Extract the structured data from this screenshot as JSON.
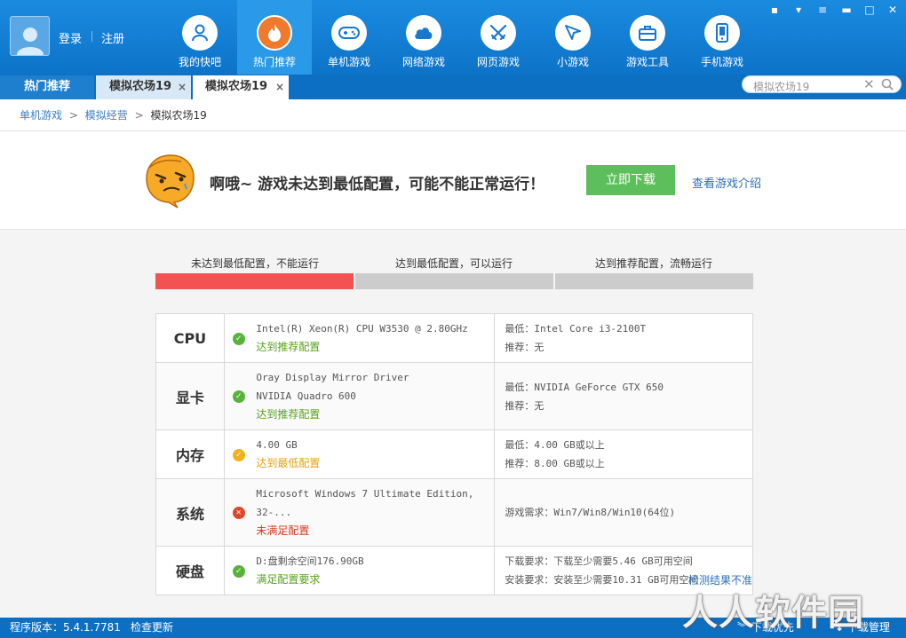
{
  "header": {
    "login": "登录",
    "register": "注册",
    "nav": [
      {
        "label": "我的快吧",
        "icon": "user-icon"
      },
      {
        "label": "热门推荐",
        "icon": "flame-icon",
        "active": true
      },
      {
        "label": "单机游戏",
        "icon": "gamepad-icon"
      },
      {
        "label": "网络游戏",
        "icon": "cloud-icon"
      },
      {
        "label": "网页游戏",
        "icon": "crossed-swords-icon"
      },
      {
        "label": "小游戏",
        "icon": "cursor-arrow-icon"
      },
      {
        "label": "游戏工具",
        "icon": "toolbox-icon"
      },
      {
        "label": "手机游戏",
        "icon": "phone-icon"
      }
    ],
    "window_controls": [
      "chat-icon",
      "shirt-icon",
      "menu-icon",
      "minimize-icon",
      "maximize-icon",
      "close-icon"
    ]
  },
  "tabs": {
    "hot": "热门推荐",
    "game1": "模拟农场19",
    "game2": "模拟农场19",
    "close_glyph": "×"
  },
  "search": {
    "placeholder": "模拟农场19"
  },
  "breadcrumb": {
    "level1": "单机游戏",
    "level2": "模拟经营",
    "current": "模拟农场19",
    "separator": ">"
  },
  "alert": {
    "message": "啊哦~ 游戏未达到最低配置，可能不能正常运行！",
    "download_button": "立即下载",
    "intro_link": "查看游戏介绍"
  },
  "levels": [
    {
      "label": "未达到最低配置，不能运行",
      "active": true
    },
    {
      "label": "达到最低配置，可以运行",
      "active": false
    },
    {
      "label": "达到推荐配置，流畅运行",
      "active": false
    }
  ],
  "specs": [
    {
      "name": "CPU",
      "status_type": "ok",
      "detail": [
        "Intel(R) Xeon(R) CPU W3530 @ 2.80GHz"
      ],
      "status": "达到推荐配置",
      "req": [
        "最低：Intel Core i3-2100T",
        "推荐：无"
      ]
    },
    {
      "name": "显卡",
      "status_type": "ok",
      "detail": [
        "Oray Display Mirror Driver",
        "NVIDIA Quadro 600"
      ],
      "status": "达到推荐配置",
      "req": [
        "最低：NVIDIA GeForce GTX 650",
        "推荐：无"
      ]
    },
    {
      "name": "内存",
      "status_type": "min",
      "detail": [
        "4.00 GB"
      ],
      "status": "达到最低配置",
      "req": [
        "最低：4.00 GB或以上",
        "推荐：8.00 GB或以上"
      ]
    },
    {
      "name": "系统",
      "status_type": "fail",
      "detail": [
        "Microsoft Windows 7 Ultimate Edition, 32-..."
      ],
      "status": "未满足配置",
      "req": [
        "游戏需求：Win7/Win8/Win10(64位)"
      ]
    },
    {
      "name": "硬盘",
      "status_type": "ok",
      "detail": [
        "D:盘剩余空间176.90GB"
      ],
      "status": "满足配置要求",
      "req": [
        "下载要求：下载至少需要5.46 GB可用空间",
        "安装要求：安装至少需要10.31 GB可用空间"
      ]
    }
  ],
  "inaccurate_link": "检测结果不准",
  "statusbar": {
    "version": "程序版本：5.4.1.7781",
    "check_update": "检查更新",
    "download_first": "下载优先",
    "download_manager": "下载管理"
  },
  "watermark": "人人软件园",
  "colors": {
    "primary_blue": "#0d73c8",
    "download_green": "#5cbf5c",
    "fail_red": "#f45252",
    "ok_green": "#58a11c",
    "min_orange": "#e8a10c"
  }
}
